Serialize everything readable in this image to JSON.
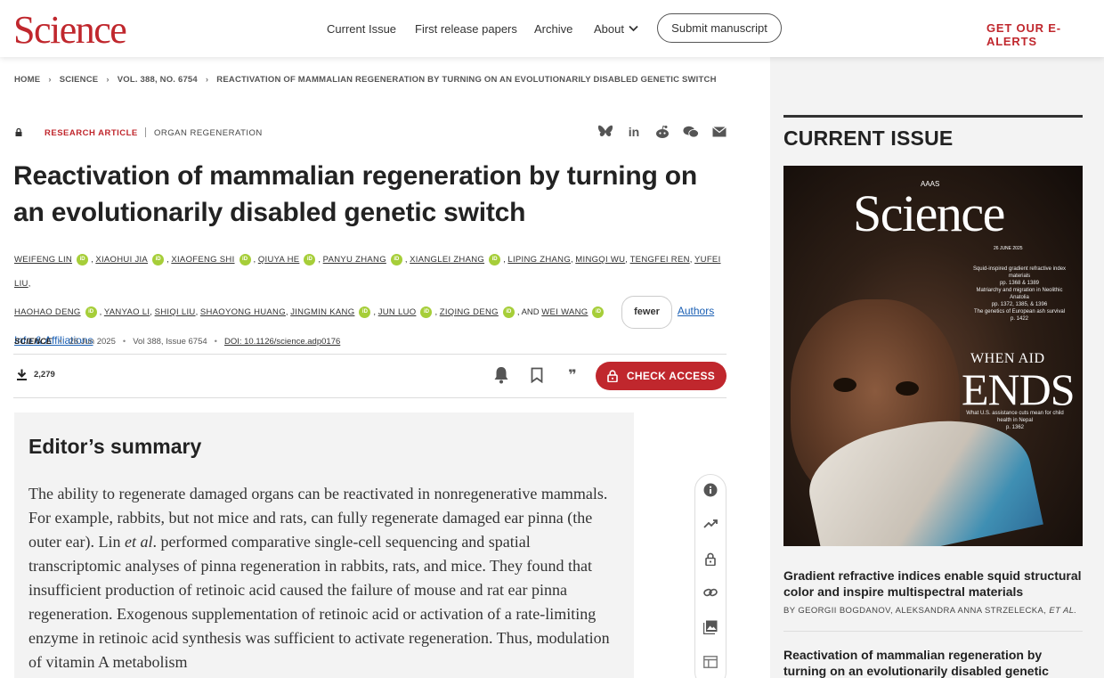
{
  "header": {
    "logo": "Science",
    "nav": [
      "Current Issue",
      "First release papers",
      "Archive"
    ],
    "about": "About",
    "submit": "Submit manuscript",
    "ealerts": "GET OUR E-ALERTS"
  },
  "breadcrumb": [
    "HOME",
    "SCIENCE",
    "VOL. 388, NO. 6754",
    "REACTIVATION OF MAMMALIAN REGENERATION BY TURNING ON AN EVOLUTIONARILY DISABLED GENETIC SWITCH"
  ],
  "article": {
    "type": "RESEARCH ARTICLE",
    "topic": "ORGAN REGENERATION",
    "title": "Reactivation of mammalian regeneration by turning on an evolutionarily disabled genetic switch",
    "authors": [
      "WEIFENG LIN",
      "XIAOHUI JIA",
      "XIAOFENG SHI",
      "QIUYA HE",
      "PANYU ZHANG",
      "XIANGLEI ZHANG",
      "LIPING ZHANG",
      "MINGQI WU",
      "TENGFEI REN",
      "YUFEI LIU",
      "HAOHAO DENG",
      "YANYAO LI",
      "SHIQI LIU",
      "SHAOYONG HUANG",
      "JINGMIN KANG",
      "JUN LUO",
      "ZIQING DENG",
      "WEI WANG"
    ],
    "and_label": ", AND",
    "fewer_label": "fewer",
    "affiliations_label": "Authors Info & Affiliations",
    "journal": "SCIENCE",
    "date": "26 Jun 2025",
    "volume": "Vol 388, Issue 6754",
    "doi": "DOI: 10.1126/science.adp0176",
    "downloads": "2,279",
    "check_access": "CHECK ACCESS"
  },
  "summary": {
    "heading": "Editor’s summary",
    "text_before": "The ability to regenerate damaged organs can be reactivated in nonregenerative mammals. For example, rabbits, but not mice and rats, can fully regenerate damaged ear pinna (the outer ear). Lin ",
    "text_italic": "et al",
    "text_after": ". performed comparative single-cell sequencing and spatial transcriptomic analyses of pinna regeneration in rabbits, rats, and mice. They found that insufficient production of retinoic acid caused the failure of mouse and rat ear pinna regeneration. Exogenous supplementation of retinoic acid or activation of a rate-limiting enzyme in retinoic acid synthesis was sufficient to activate regeneration. Thus, modulation of vitamin A metabolism"
  },
  "current_issue": {
    "heading": "CURRENT ISSUE",
    "cover": {
      "aaas": "AAAS",
      "title": "Science",
      "date": "26 JUNE 2025",
      "lines": [
        "Squid-inspired gradient refractive index materials",
        "pp. 1368 & 1389",
        "Matriarchy and migration in Neolithic Anatolia",
        "pp. 1372, 1385, & 1396",
        "The genetics of European ash survival",
        "p. 1422"
      ],
      "when": "WHEN AID",
      "ends": "ENDS",
      "sub": "What U.S. assistance cuts mean for child health in Nepal",
      "page": "p. 1362"
    },
    "items": [
      {
        "title": "Gradient refractive indices enable squid structural color and inspire multispectral materials",
        "authors": "BY GEORGII BOGDANOV, ALEKSANDRA ANNA STRZELECKA,",
        "etal": "ET AL."
      },
      {
        "title": "Reactivation of mammalian regeneration by turning on an evolutionarily disabled genetic switch"
      }
    ]
  }
}
